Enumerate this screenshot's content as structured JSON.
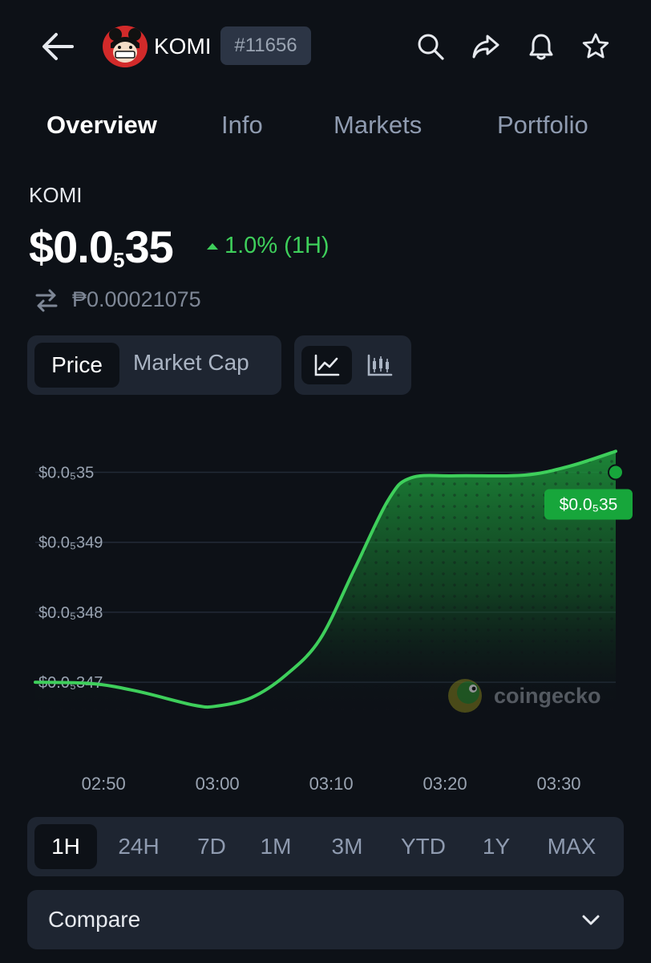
{
  "header": {
    "coin_name": "KOMI",
    "rank": "#11656",
    "icons": [
      "back-arrow-icon",
      "search-icon",
      "share-icon",
      "bell-icon",
      "star-icon"
    ]
  },
  "tabs": [
    {
      "label": "Overview",
      "active": true
    },
    {
      "label": "Info",
      "active": false
    },
    {
      "label": "Markets",
      "active": false
    },
    {
      "label": "Portfolio",
      "active": false
    }
  ],
  "price_block": {
    "symbol": "KOMI",
    "price_prefix": "$0.0",
    "price_zeros": "5",
    "price_digits": "35",
    "change": "1.0% (1H)",
    "converted": "₱0.00021075"
  },
  "toggles": {
    "price": "Price",
    "market_cap": "Market Cap",
    "selected": "Price",
    "chart_type_selected": "line-chart-icon",
    "chart_type_other": "candlestick-icon"
  },
  "chart_data": {
    "type": "area",
    "y_ticks": [
      {
        "label": "$0.0₅35",
        "value": 3.5e-06
      },
      {
        "label": "$0.0₅349",
        "value": 3.49e-06
      },
      {
        "label": "$0.0₅348",
        "value": 3.48e-06
      },
      {
        "label": "$0.0₅347",
        "value": 3.47e-06
      }
    ],
    "x_ticks": [
      "02:50",
      "03:00",
      "03:10",
      "03:20",
      "03:30"
    ],
    "ylim": [
      3.466e-06,
      3.5035e-06
    ],
    "xlim": [
      "02:44",
      "03:35"
    ],
    "points": [
      [
        "02:44",
        3.47e-06
      ],
      [
        "02:49",
        3.4698e-06
      ],
      [
        "02:53",
        3.4687e-06
      ],
      [
        "02:58",
        3.4667e-06
      ],
      [
        "03:00",
        3.4666e-06
      ],
      [
        "03:03",
        3.4678e-06
      ],
      [
        "03:06",
        3.471e-06
      ],
      [
        "03:09",
        3.4761e-06
      ],
      [
        "03:12",
        3.486e-06
      ],
      [
        "03:15",
        3.496e-06
      ],
      [
        "03:17",
        3.4992e-06
      ],
      [
        "03:21",
        3.4995e-06
      ],
      [
        "03:27",
        3.4996e-06
      ],
      [
        "03:31",
        3.5009e-06
      ],
      [
        "03:35",
        3.503e-06
      ]
    ],
    "current_label": "$0.0₅35",
    "watermark": "coingecko",
    "line_color": "#3ecf5b",
    "label_bg": "#17a63b",
    "grid": true
  },
  "ranges": [
    {
      "label": "1H",
      "active": true
    },
    {
      "label": "24H",
      "active": false
    },
    {
      "label": "7D",
      "active": false
    },
    {
      "label": "1M",
      "active": false
    },
    {
      "label": "3M",
      "active": false
    },
    {
      "label": "YTD",
      "active": false
    },
    {
      "label": "1Y",
      "active": false
    },
    {
      "label": "MAX",
      "active": false
    }
  ],
  "compare": {
    "label": "Compare"
  }
}
